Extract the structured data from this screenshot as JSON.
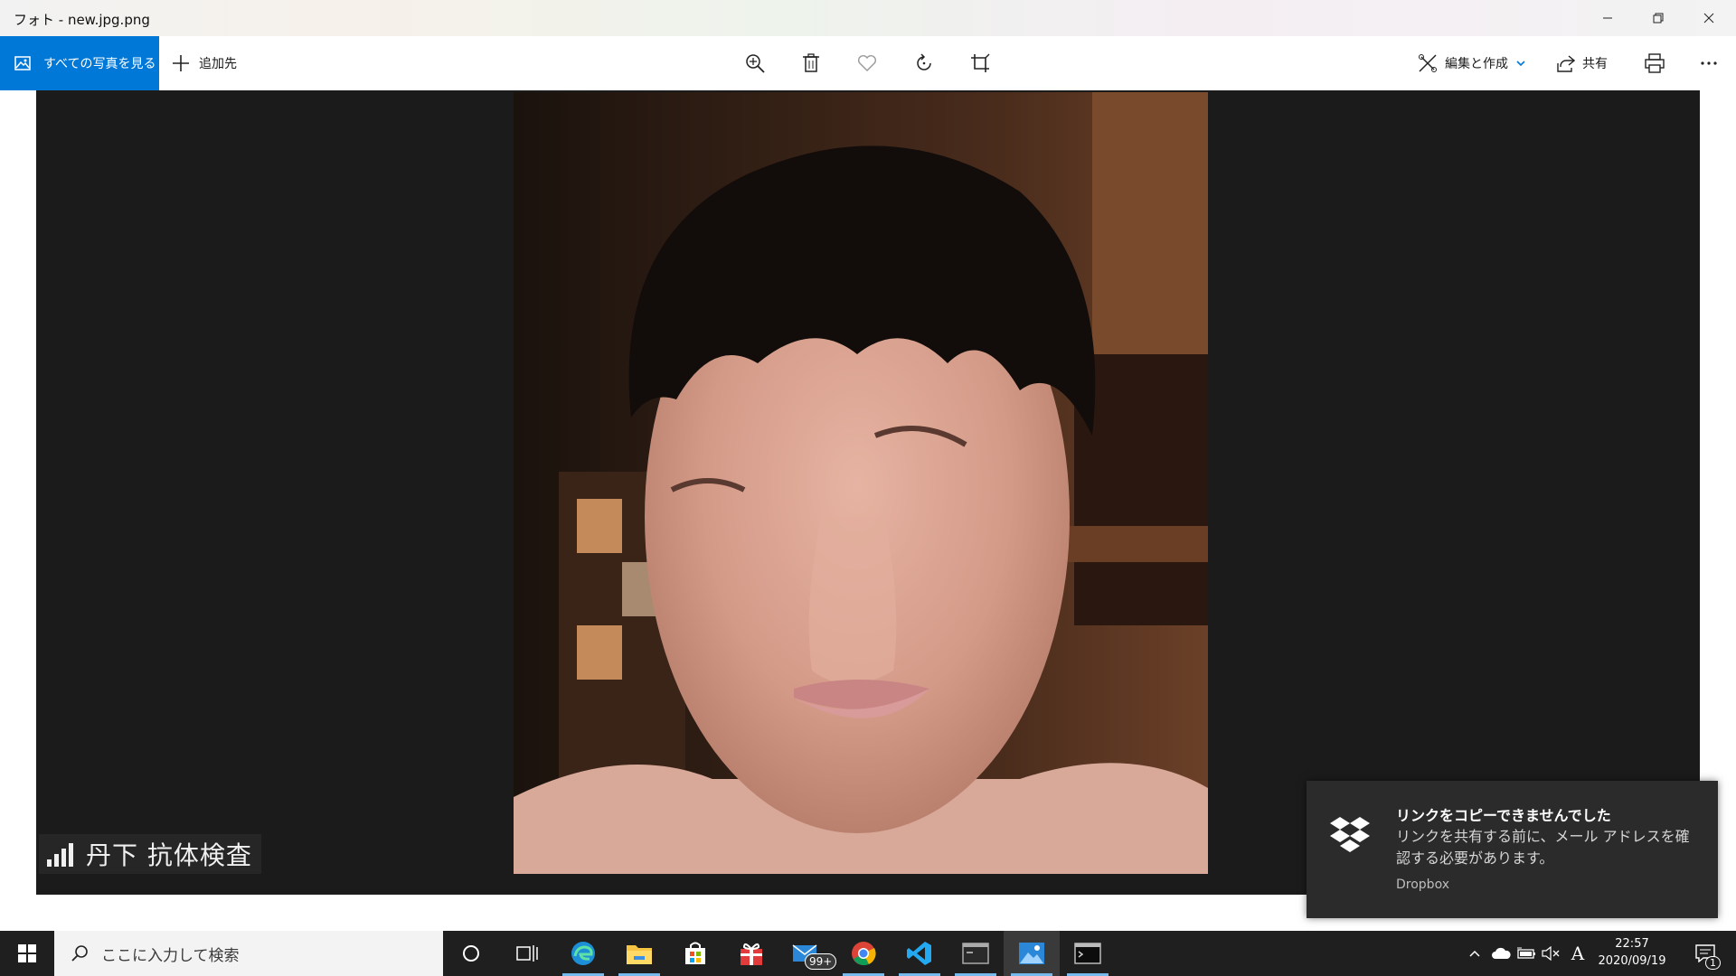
{
  "window": {
    "title": "フォト - new.jpg.png"
  },
  "toolbar": {
    "see_all_label": "すべての写真を見る",
    "add_to_label": "追加先",
    "edit_create_label": "編集と作成",
    "share_label": "共有",
    "icons": [
      "zoom-in-icon",
      "delete-icon",
      "favorite-icon",
      "rotate-icon",
      "crop-icon",
      "print-icon",
      "more-icon"
    ]
  },
  "photo": {
    "watermark_text": "丹下 抗体検査"
  },
  "toast": {
    "title": "リンクをコピーできませんでした",
    "body": "リンクを共有する前に、メール アドレスを確認する必要があります。",
    "source": "Dropbox"
  },
  "taskbar": {
    "search_placeholder": "ここに入力して検索",
    "mail_badge": "99+",
    "time": "22:57",
    "date": "2020/09/19",
    "notification_count": "1",
    "ime_label": "A"
  },
  "colors": {
    "accent": "#0078d7",
    "viewer_bg": "#1b1b1b",
    "taskbar_bg": "#1f1f1f",
    "toast_bg": "#2b2b2b"
  }
}
